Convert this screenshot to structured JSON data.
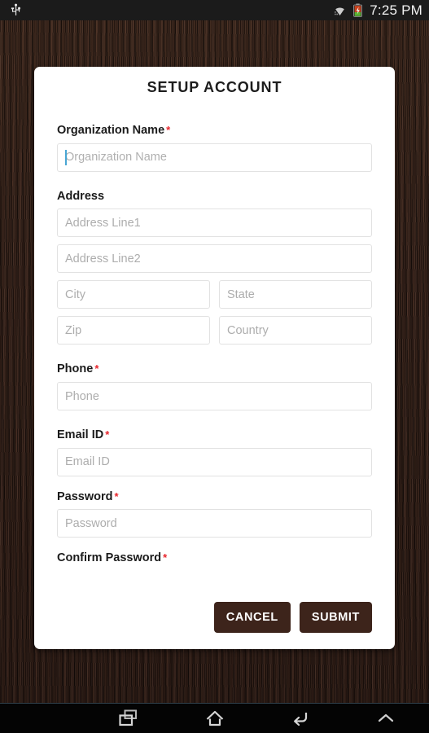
{
  "status_bar": {
    "usb_icon": "usb-icon",
    "wifi_icon": "wifi-icon",
    "battery_icon": "battery-icon",
    "clock": "7:25 PM"
  },
  "card": {
    "title": "SETUP ACCOUNT",
    "accent_color": "#3d241b",
    "required_color": "#e8262d",
    "caret_color": "#49a6d4"
  },
  "form": {
    "organization": {
      "label": "Organization Name",
      "required": "*",
      "placeholder": "Organization Name",
      "value": ""
    },
    "address": {
      "label": "Address",
      "required": "",
      "line1_placeholder": "Address Line1",
      "line1_value": "",
      "line2_placeholder": "Address Line2",
      "line2_value": "",
      "city_placeholder": "City",
      "city_value": "",
      "state_placeholder": "State",
      "state_value": "",
      "zip_placeholder": "Zip",
      "zip_value": "",
      "country_placeholder": "Country",
      "country_value": ""
    },
    "phone": {
      "label": "Phone",
      "required": "*",
      "placeholder": "Phone",
      "value": ""
    },
    "email": {
      "label": "Email ID",
      "required": "*",
      "placeholder": "Email ID",
      "value": ""
    },
    "password": {
      "label": "Password",
      "required": "*",
      "placeholder": "Password",
      "value": ""
    },
    "confirm_password": {
      "label": "Confirm Password",
      "required": "*"
    }
  },
  "actions": {
    "cancel_label": "CANCEL",
    "submit_label": "SUBMIT"
  },
  "nav_bar": {
    "recents_icon": "recents-icon",
    "home_icon": "home-icon",
    "back_icon": "back-icon",
    "expand_icon": "chevron-up-icon"
  }
}
